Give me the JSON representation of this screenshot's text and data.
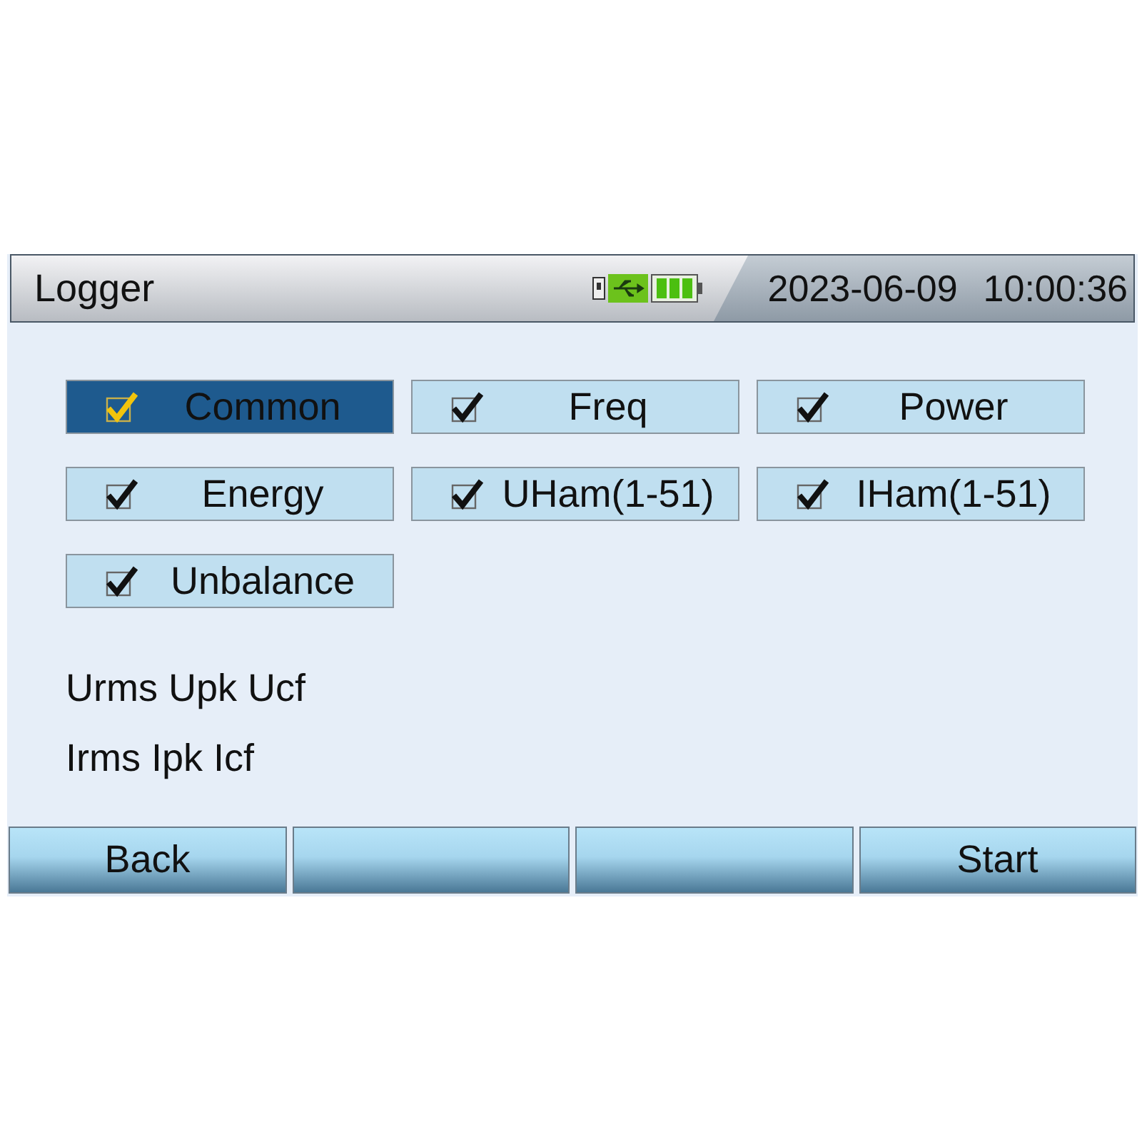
{
  "title_bar": {
    "title": "Logger",
    "date": "2023-06-09",
    "time": "10:00:36"
  },
  "options": [
    {
      "label": "Common",
      "checked": true,
      "selected": true
    },
    {
      "label": "Freq",
      "checked": true,
      "selected": false
    },
    {
      "label": "Power",
      "checked": true,
      "selected": false
    },
    {
      "label": "Energy",
      "checked": true,
      "selected": false
    },
    {
      "label": "UHam(1-51)",
      "checked": true,
      "selected": false
    },
    {
      "label": "IHam(1-51)",
      "checked": true,
      "selected": false
    },
    {
      "label": "Unbalance",
      "checked": true,
      "selected": false
    }
  ],
  "parameter_lines": [
    "Urms Upk Ucf",
    "Irms Ipk Icf"
  ],
  "softkeys": [
    {
      "kind": "text",
      "label": "Back"
    },
    {
      "kind": "blank"
    },
    {
      "kind": "blank"
    },
    {
      "kind": "text",
      "label": "Start"
    }
  ]
}
